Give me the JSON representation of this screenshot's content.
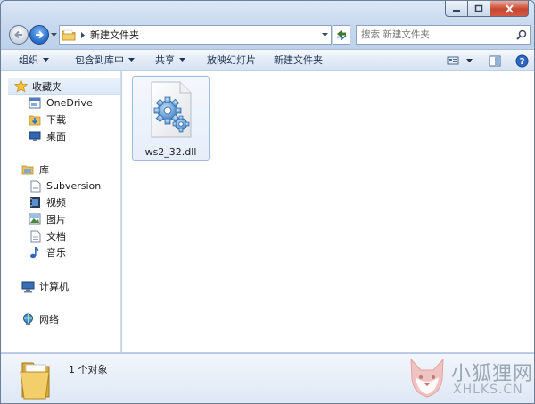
{
  "address": {
    "current_folder": "新建文件夹"
  },
  "search": {
    "placeholder": "搜索 新建文件夹"
  },
  "toolbar": {
    "organize": "组织",
    "include_in_library": "包含到库中",
    "share": "共享",
    "slideshow": "放映幻灯片",
    "new_folder": "新建文件夹"
  },
  "sidebar": {
    "favorites": "收藏夹",
    "onedrive": "OneDrive",
    "downloads": "下载",
    "desktop": "桌面",
    "libraries": "库",
    "subversion": "Subversion",
    "videos": "视频",
    "pictures": "图片",
    "documents": "文档",
    "music": "音乐",
    "computer": "计算机",
    "network": "网络"
  },
  "files": [
    {
      "name": "ws2_32.dll",
      "icon": "dll-settings-icon"
    }
  ],
  "details": {
    "count_text": "1 个对象"
  },
  "watermark": {
    "title": "小狐狸网",
    "subtitle": "XHLKS.CN"
  },
  "colors": {
    "accent": "#2a6fcf",
    "close": "#c7462f",
    "selection": "#dce8f7"
  }
}
